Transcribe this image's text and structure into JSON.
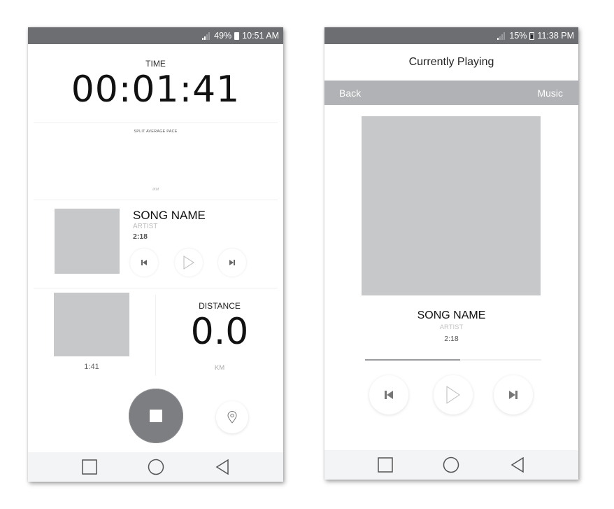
{
  "left_screen": {
    "status_bar": {
      "signal_icon": "signal-icon",
      "battery_percent": "49%",
      "battery_icon": "battery-icon",
      "time": "10:51 AM"
    },
    "time": {
      "label": "TIME",
      "value": "00:01:41"
    },
    "split_pace": {
      "label": "SPLIT AVERAGE PACE",
      "value": "-:--",
      "unit": "/KM"
    },
    "now_playing": {
      "song_name": "SONG NAME",
      "artist": "ARTIST",
      "duration": "2:18",
      "controls": [
        "previous-icon",
        "play-icon",
        "next-icon"
      ]
    },
    "split": {
      "thumbnail_time": "1:41"
    },
    "distance": {
      "label": "DISTANCE",
      "value": "0.0",
      "unit": "KM"
    },
    "actions": {
      "stop_icon": "stop-icon",
      "location_icon": "location-pin-icon"
    },
    "nav_bar": [
      "recents-icon",
      "home-icon",
      "back-icon"
    ]
  },
  "right_screen": {
    "status_bar": {
      "signal_icon": "signal-icon",
      "battery_percent": "15%",
      "battery_icon": "battery-low-icon",
      "time": "11:38 PM"
    },
    "header": {
      "title": "Currently Playing"
    },
    "subbar": {
      "back_label": "Back",
      "music_label": "Music"
    },
    "track": {
      "song_name": "SONG NAME",
      "artist": "ARTIST",
      "duration": "2:18",
      "progress_fraction": 0.54
    },
    "controls": [
      "previous-icon",
      "play-icon",
      "next-icon"
    ],
    "nav_bar": [
      "recents-icon",
      "home-icon",
      "back-icon"
    ]
  },
  "colors": {
    "status_bar": "#6d6e71",
    "subbar": "#b1b2b5",
    "placeholder_art": "#c7c8ca",
    "stop_button": "#7d7e81",
    "nav_bar": "#f3f4f6"
  }
}
